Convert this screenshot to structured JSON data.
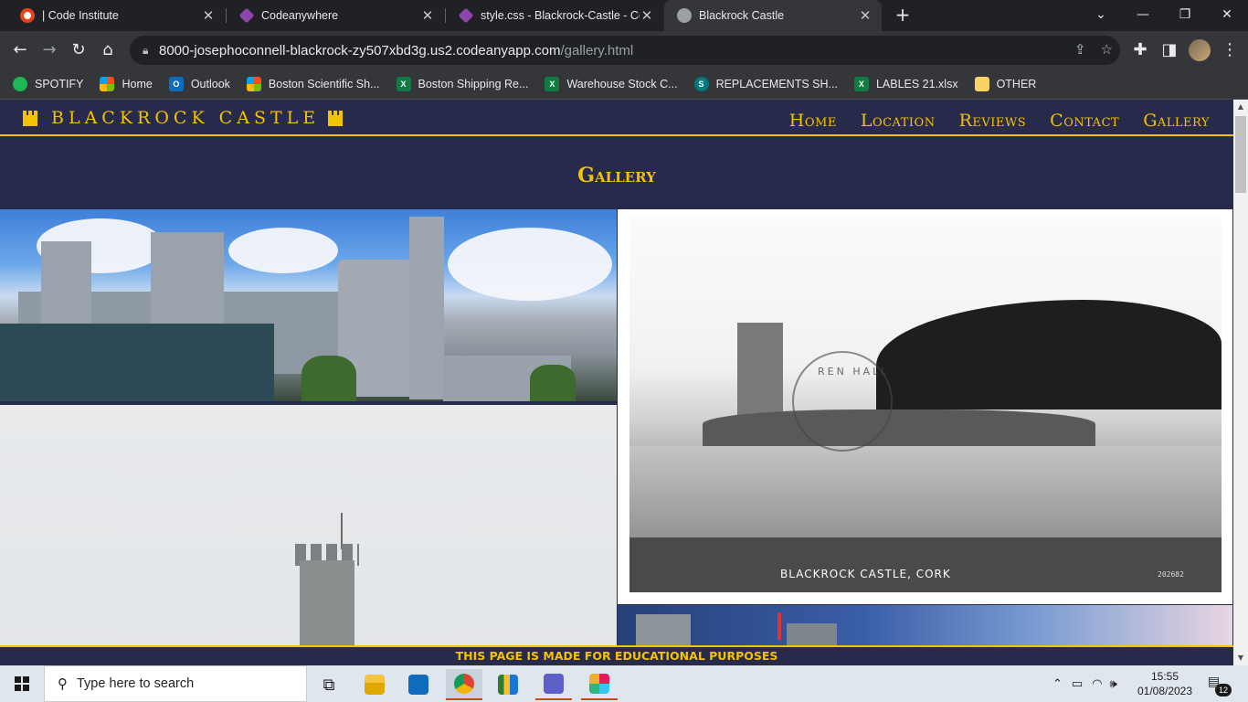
{
  "browser": {
    "tabs": [
      {
        "title": "| Code Institute",
        "icon": "code-institute-icon"
      },
      {
        "title": "Codeanywhere",
        "icon": "codeanywhere-icon"
      },
      {
        "title": "style.css - Blackrock-Castle - Cod",
        "icon": "codeanywhere-icon"
      },
      {
        "title": "Blackrock Castle",
        "icon": "globe-icon",
        "active": true
      }
    ],
    "url_host": "8000-josephoconnell-blackrock-zy507xbd3g.us2.codeanyapp.com",
    "url_path": "/gallery.html",
    "bookmarks": [
      {
        "label": "SPOTIFY",
        "icon": "spotify-icon"
      },
      {
        "label": "Home",
        "icon": "microsoft-icon"
      },
      {
        "label": "Outlook",
        "icon": "outlook-icon"
      },
      {
        "label": "Boston Scientific Sh...",
        "icon": "microsoft-icon"
      },
      {
        "label": "Boston Shipping Re...",
        "icon": "excel-icon"
      },
      {
        "label": "Warehouse Stock C...",
        "icon": "excel-icon"
      },
      {
        "label": "REPLACEMENTS SH...",
        "icon": "sharepoint-icon"
      },
      {
        "label": "LABLES 21.xlsx",
        "icon": "excel-icon"
      },
      {
        "label": "OTHER",
        "icon": "folder-icon"
      }
    ]
  },
  "site": {
    "brand": "BLACKROCK CASTLE",
    "nav": [
      "Home",
      "Location",
      "Reviews",
      "Contact",
      "Gallery"
    ],
    "page_title": "Gallery",
    "postcard_caption": "BLACKROCK CASTLE, CORK",
    "postcard_code": "202682",
    "postcard_stamp": "REN HALL",
    "footer": "THIS PAGE IS MADE FOR EDUCATIONAL PURPOSES",
    "colors": {
      "background": "#272a4b",
      "accent": "#f3c200"
    }
  },
  "taskbar": {
    "search_placeholder": "Type here to search",
    "time": "15:55",
    "date": "01/08/2023",
    "notification_count": "12"
  }
}
